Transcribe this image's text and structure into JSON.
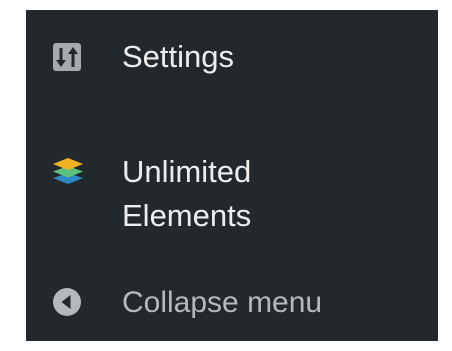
{
  "menu": {
    "settings": {
      "icon": "settings-sliders-icon",
      "label": "Settings"
    },
    "unlimited_elements": {
      "icon": "layers-icon",
      "label_line1": "Unlimited",
      "label_line2": "Elements"
    },
    "collapse": {
      "icon": "collapse-arrow-icon",
      "label": "Collapse menu"
    }
  },
  "colors": {
    "menu_background": "#23282d",
    "text": "#eeeeee",
    "muted_text": "#b4b9be",
    "settings_icon_bg": "#a7aaad",
    "layer_orange": "#f0b323",
    "layer_green": "#5bbf7e",
    "layer_blue": "#2f89c6",
    "collapse_icon_bg": "#b4b9be"
  }
}
